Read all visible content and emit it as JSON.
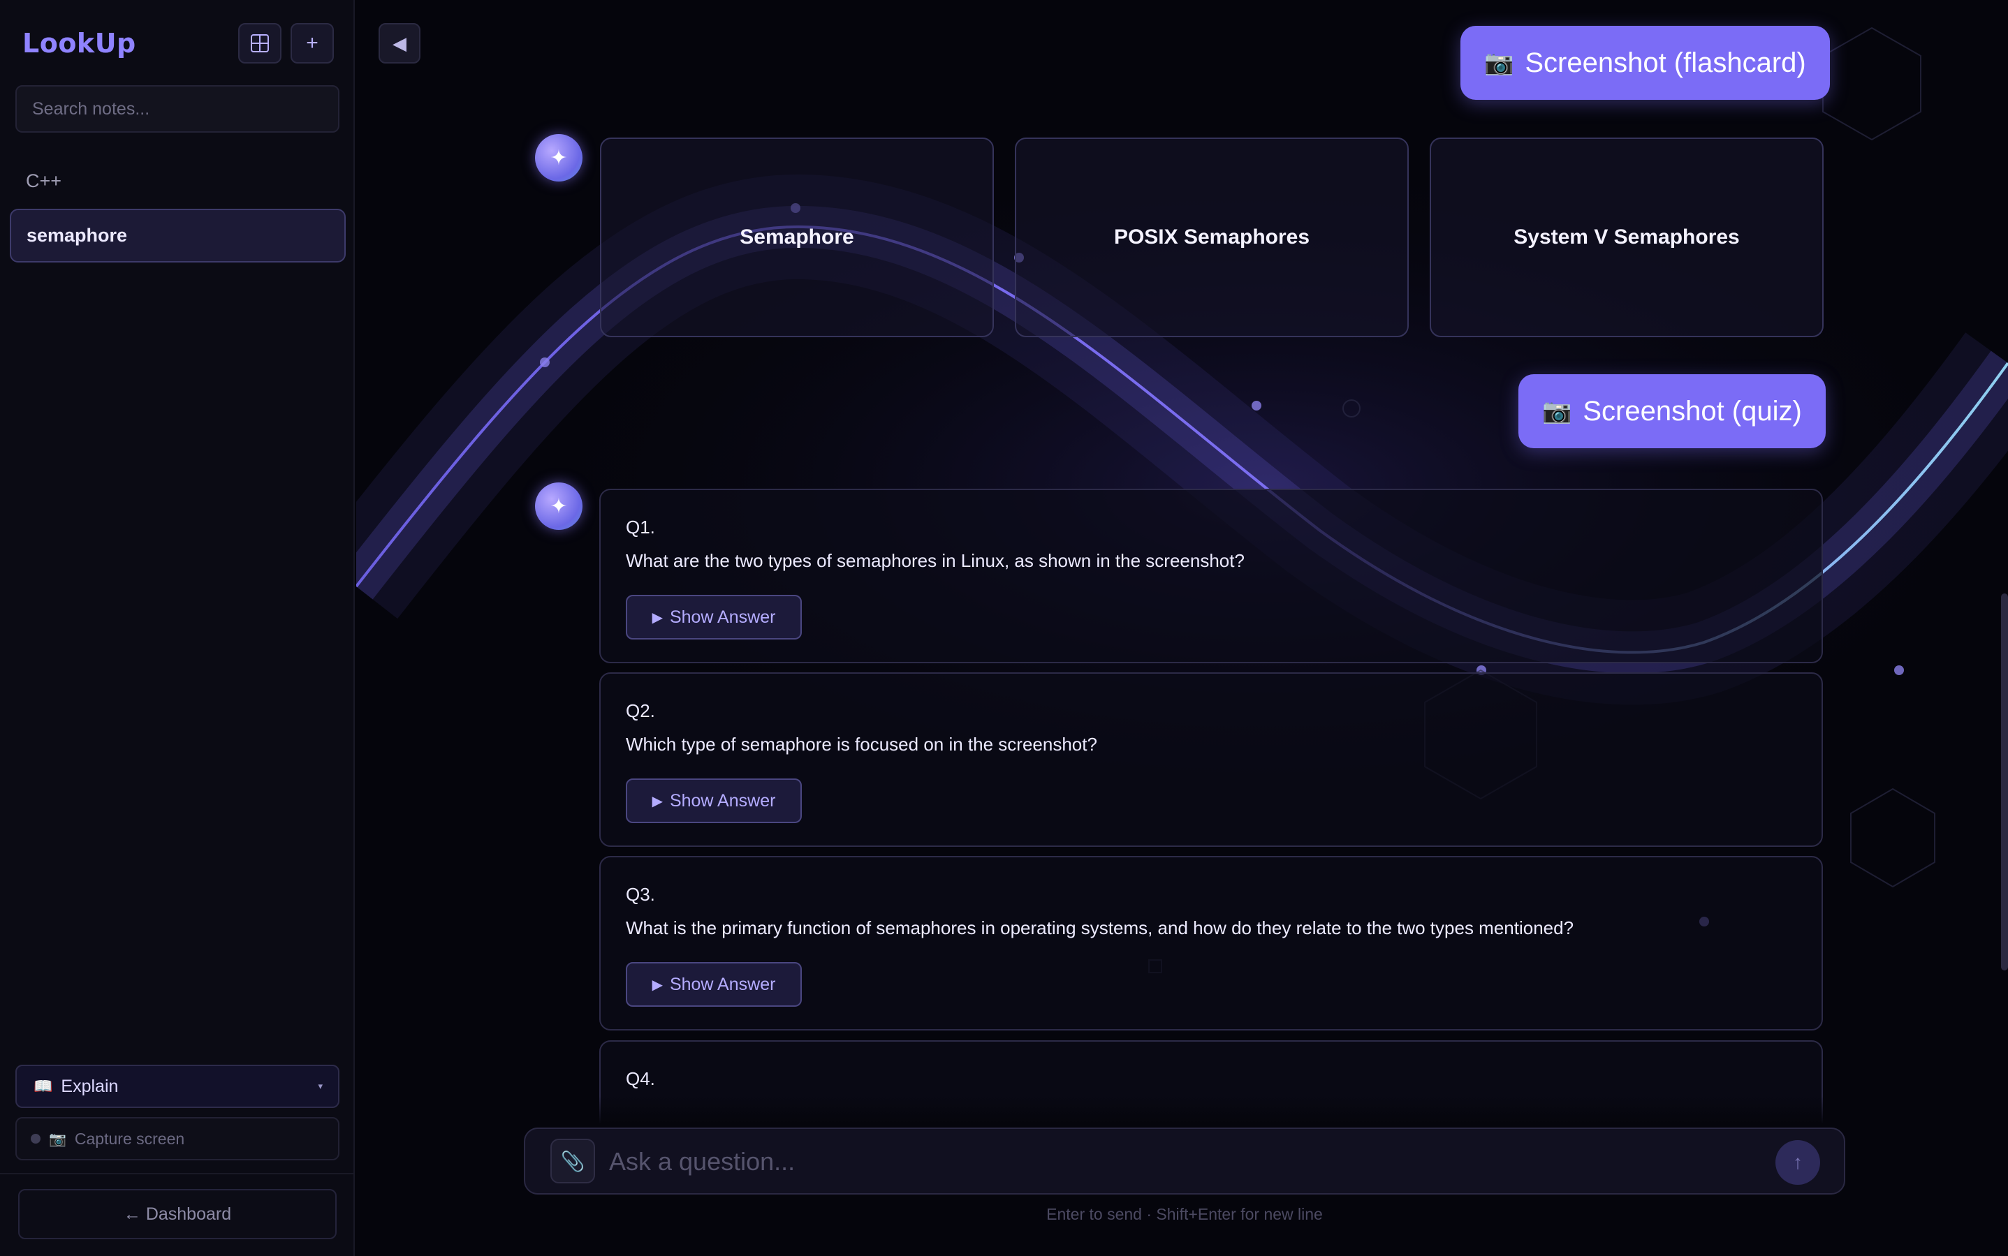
{
  "app": {
    "name": "LookUp"
  },
  "sidebar": {
    "grid_icon": "grid-icon",
    "new_icon": "plus-icon",
    "new_glyph": "+",
    "search_placeholder": "Search notes...",
    "folder": "C++",
    "notes": [
      {
        "label": "semaphore",
        "active": true
      }
    ],
    "mode": {
      "emoji": "📖",
      "label": "Explain",
      "chevron": "▾"
    },
    "capture": {
      "emoji": "📷",
      "label": "Capture screen"
    },
    "dashboard_label": "← Dashboard"
  },
  "main": {
    "collapse_glyph": "◀",
    "avatar_glyph": "✦",
    "messages": {
      "flashcard_prompt": {
        "emoji": "📷",
        "label": "Screenshot (flashcard)"
      },
      "flashcards": [
        "Semaphore",
        "POSIX Semaphores",
        "System V Semaphores"
      ],
      "quiz_prompt": {
        "emoji": "📷",
        "label": "Screenshot (quiz)"
      },
      "quiz": [
        {
          "number": "Q1.",
          "question": "What are the two types of semaphores in Linux, as shown in the screenshot?",
          "button": "Show Answer"
        },
        {
          "number": "Q2.",
          "question": "Which type of semaphore is focused on in the screenshot?",
          "button": "Show Answer"
        },
        {
          "number": "Q3.",
          "question": "What is the primary function of semaphores in operating systems, and how do they relate to the two types mentioned?",
          "button": "Show Answer"
        },
        {
          "number": "Q4."
        }
      ],
      "play_glyph": "▶"
    },
    "composer": {
      "attach_icon": "paperclip-icon",
      "attach_glyph": "📎",
      "placeholder": "Ask a question...",
      "send_glyph": "↑",
      "hint": "Enter to send · Shift+Enter for new line"
    }
  },
  "colors": {
    "accent": "#7b6cf6",
    "logo": "#8f83ff",
    "background": "#05050c",
    "sidebar": "#0b0b14",
    "wave": "#7a6af0"
  }
}
